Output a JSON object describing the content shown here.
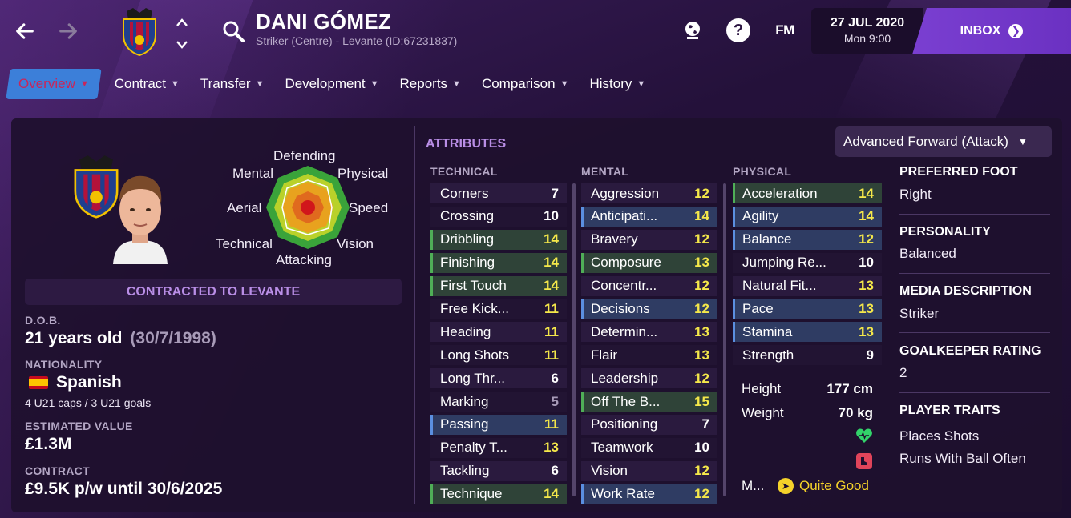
{
  "header": {
    "player_name": "DANI GÓMEZ",
    "player_subtitle": "Striker (Centre) - Levante (ID:67231837)",
    "icons": [
      "back-arrow-icon",
      "forward-arrow-icon",
      "club-crest-icon",
      "up-down-icon",
      "search-icon",
      "globe-icon",
      "help-icon",
      "fm-logo"
    ],
    "fm_label": "FM",
    "help_label": "?",
    "date": "27 JUL 2020",
    "time": "Mon 9:00",
    "inbox_label": "INBOX",
    "inbox_go": "❯"
  },
  "tabs": [
    {
      "label": "Overview",
      "active": true
    },
    {
      "label": "Contract"
    },
    {
      "label": "Transfer"
    },
    {
      "label": "Development"
    },
    {
      "label": "Reports"
    },
    {
      "label": "Comparison"
    },
    {
      "label": "History"
    }
  ],
  "radar": {
    "labels": [
      "Defending",
      "Physical",
      "Speed",
      "Vision",
      "Attacking",
      "Technical",
      "Aerial",
      "Mental"
    ]
  },
  "profile": {
    "contract_banner": "CONTRACTED TO LEVANTE",
    "dob_label": "D.O.B.",
    "dob_age": "21 years old",
    "dob_date": "(30/7/1998)",
    "nationality_label": "NATIONALITY",
    "nationality": "Spanish",
    "caps": "4 U21 caps / 3 U21 goals",
    "value_label": "ESTIMATED VALUE",
    "value": "£1.3M",
    "contract_label": "CONTRACT",
    "contract": "£9.5K p/w until 30/6/2025"
  },
  "attributes": {
    "title": "ATTRIBUTES",
    "role": "Advanced Forward (Attack)",
    "technical_label": "TECHNICAL",
    "mental_label": "MENTAL",
    "physical_label": "PHYSICAL",
    "technical": [
      {
        "name": "Corners",
        "value": "7",
        "hl": "",
        "vc": "white"
      },
      {
        "name": "Crossing",
        "value": "10",
        "hl": "",
        "vc": "white"
      },
      {
        "name": "Dribbling",
        "value": "14",
        "hl": "green",
        "vc": "yellow"
      },
      {
        "name": "Finishing",
        "value": "14",
        "hl": "green",
        "vc": "yellow"
      },
      {
        "name": "First Touch",
        "value": "14",
        "hl": "green",
        "vc": "yellow"
      },
      {
        "name": "Free Kick...",
        "value": "11",
        "hl": "",
        "vc": "yellow"
      },
      {
        "name": "Heading",
        "value": "11",
        "hl": "",
        "vc": "yellow"
      },
      {
        "name": "Long Shots",
        "value": "11",
        "hl": "",
        "vc": "yellow"
      },
      {
        "name": "Long Thr...",
        "value": "6",
        "hl": "",
        "vc": "white"
      },
      {
        "name": "Marking",
        "value": "5",
        "hl": "",
        "vc": "grey"
      },
      {
        "name": "Passing",
        "value": "11",
        "hl": "blue",
        "vc": "yellow"
      },
      {
        "name": "Penalty T...",
        "value": "13",
        "hl": "",
        "vc": "yellow"
      },
      {
        "name": "Tackling",
        "value": "6",
        "hl": "",
        "vc": "white"
      },
      {
        "name": "Technique",
        "value": "14",
        "hl": "green",
        "vc": "yellow"
      }
    ],
    "mental": [
      {
        "name": "Aggression",
        "value": "12",
        "hl": "",
        "vc": "yellow"
      },
      {
        "name": "Anticipati...",
        "value": "14",
        "hl": "blue",
        "vc": "yellow"
      },
      {
        "name": "Bravery",
        "value": "12",
        "hl": "",
        "vc": "yellow"
      },
      {
        "name": "Composure",
        "value": "13",
        "hl": "green",
        "vc": "yellow"
      },
      {
        "name": "Concentr...",
        "value": "12",
        "hl": "",
        "vc": "yellow"
      },
      {
        "name": "Decisions",
        "value": "12",
        "hl": "blue",
        "vc": "yellow"
      },
      {
        "name": "Determin...",
        "value": "13",
        "hl": "",
        "vc": "yellow"
      },
      {
        "name": "Flair",
        "value": "13",
        "hl": "",
        "vc": "yellow"
      },
      {
        "name": "Leadership",
        "value": "12",
        "hl": "",
        "vc": "yellow"
      },
      {
        "name": "Off The B...",
        "value": "15",
        "hl": "green",
        "vc": "yellow"
      },
      {
        "name": "Positioning",
        "value": "7",
        "hl": "",
        "vc": "white"
      },
      {
        "name": "Teamwork",
        "value": "10",
        "hl": "",
        "vc": "white"
      },
      {
        "name": "Vision",
        "value": "12",
        "hl": "",
        "vc": "yellow"
      },
      {
        "name": "Work Rate",
        "value": "12",
        "hl": "blue",
        "vc": "yellow"
      }
    ],
    "physical": [
      {
        "name": "Acceleration",
        "value": "14",
        "hl": "green",
        "vc": "yellow"
      },
      {
        "name": "Agility",
        "value": "14",
        "hl": "blue",
        "vc": "yellow"
      },
      {
        "name": "Balance",
        "value": "12",
        "hl": "blue",
        "vc": "yellow"
      },
      {
        "name": "Jumping Re...",
        "value": "10",
        "hl": "",
        "vc": "white"
      },
      {
        "name": "Natural Fit...",
        "value": "13",
        "hl": "",
        "vc": "yellow"
      },
      {
        "name": "Pace",
        "value": "13",
        "hl": "blue",
        "vc": "yellow"
      },
      {
        "name": "Stamina",
        "value": "13",
        "hl": "blue",
        "vc": "yellow"
      },
      {
        "name": "Strength",
        "value": "9",
        "hl": "",
        "vc": "white"
      }
    ],
    "height_label": "Height",
    "height": "177 cm",
    "weight_label": "Weight",
    "weight": "70 kg",
    "morale_label": "M...",
    "morale_icon": "➤",
    "morale": "Quite Good"
  },
  "info": {
    "foot_label": "PREFERRED FOOT",
    "foot": "Right",
    "personality_label": "PERSONALITY",
    "personality": "Balanced",
    "media_label": "MEDIA DESCRIPTION",
    "media": "Striker",
    "gk_label": "GOALKEEPER RATING",
    "gk": "2",
    "traits_label": "PLAYER TRAITS",
    "traits": [
      "Places Shots",
      "Runs With Ball Often"
    ]
  },
  "colors": {
    "accent_purple": "#b98ee6",
    "highlight_yellow": "#f5e84a",
    "tab_active": "#3c7fd9",
    "inbox": "#6b31c2"
  }
}
